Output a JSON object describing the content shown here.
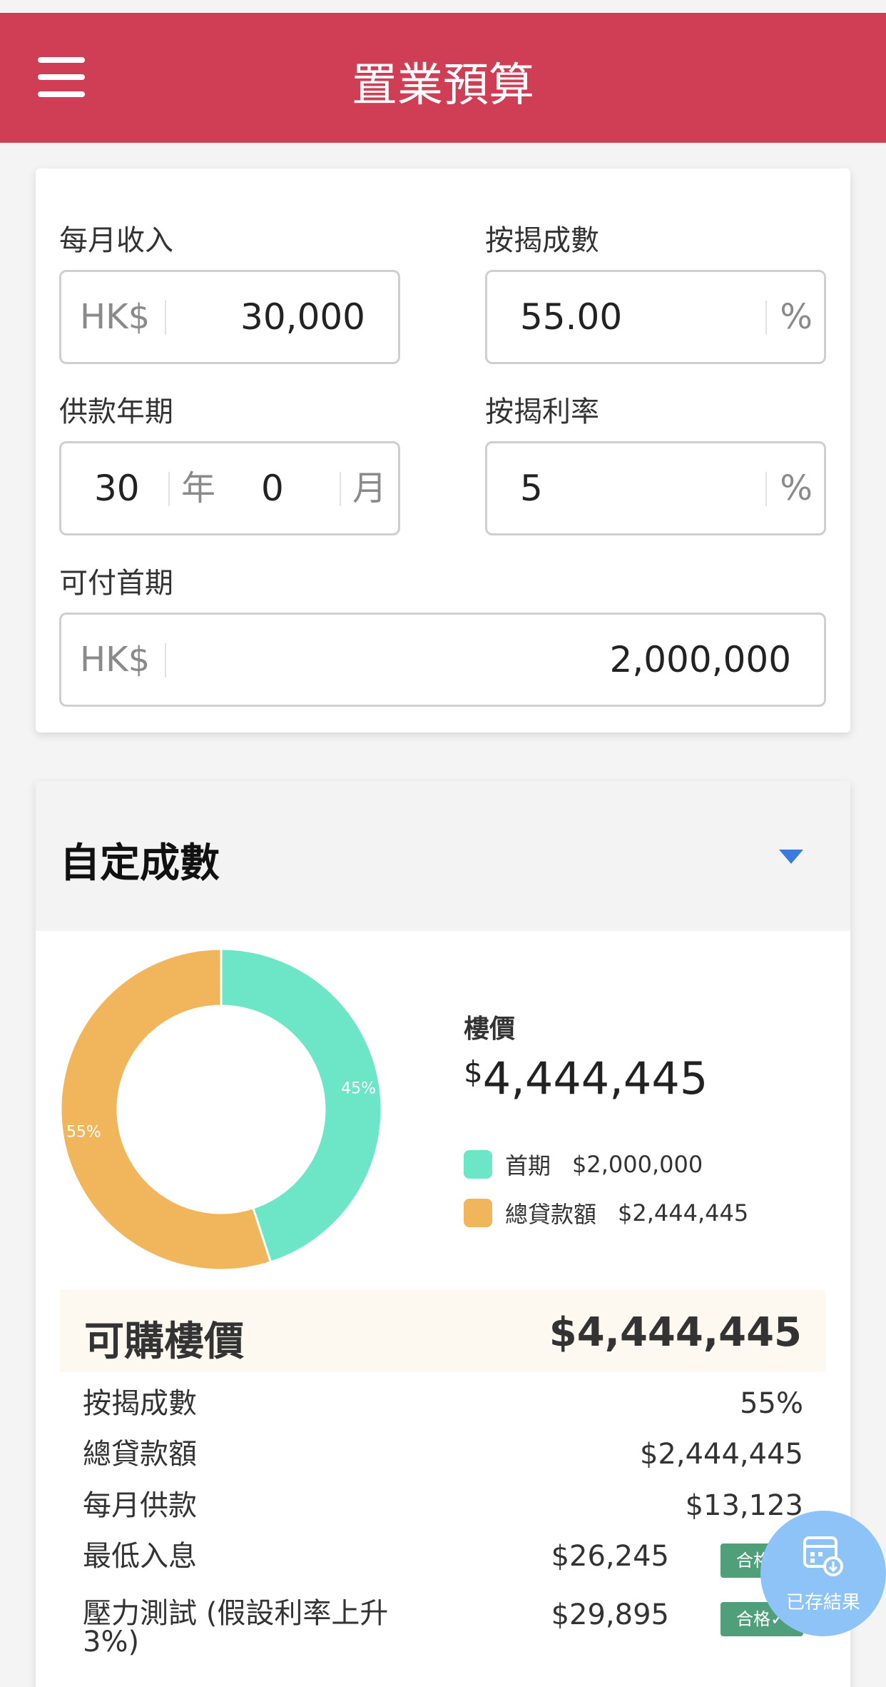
{
  "header": {
    "title": "置業預算"
  },
  "form": {
    "monthly_income": {
      "label": "每月收入",
      "prefix": "HK$",
      "value": "30,000"
    },
    "mortgage_ratio": {
      "label": "按揭成數",
      "value": "55.00",
      "suffix": "%"
    },
    "loan_term": {
      "label": "供款年期",
      "years": "30",
      "years_unit": "年",
      "months": "0",
      "months_unit": "月"
    },
    "interest_rate": {
      "label": "按揭利率",
      "value": "5",
      "suffix": "%"
    },
    "down_payment": {
      "label": "可付首期",
      "prefix": "HK$",
      "value": "2,000,000"
    }
  },
  "custom_section": {
    "title": "自定成數"
  },
  "chart_data": {
    "type": "pie",
    "categories": [
      "首期",
      "總貸款額"
    ],
    "values": [
      45,
      55
    ],
    "value_labels": [
      "45%",
      "55%"
    ],
    "colors": [
      "#6ce6c6",
      "#f1b65c"
    ]
  },
  "legend": {
    "title": "樓價",
    "total_currency": "$",
    "total_value": "4,444,445",
    "items": [
      {
        "label": "首期",
        "value": "$2,000,000",
        "color": "#6ce6c6"
      },
      {
        "label": "總貸款額",
        "value": "$2,444,445",
        "color": "#f1b65c"
      }
    ]
  },
  "result": {
    "label": "可購樓價",
    "value": "$4,444,445"
  },
  "details": [
    {
      "label": "按揭成數",
      "value": "55%"
    },
    {
      "label": "總貸款額",
      "value": "$2,444,445"
    },
    {
      "label": "每月供款",
      "value": "$13,123"
    },
    {
      "label": "最低入息",
      "value": "$26,245",
      "badge": "合格"
    },
    {
      "label_line1": "壓力測試 (假設利率上升",
      "label_line2": "3%)",
      "value": "$29,895",
      "badge": "合格✓"
    }
  ],
  "fab": {
    "label": "已存結果"
  }
}
